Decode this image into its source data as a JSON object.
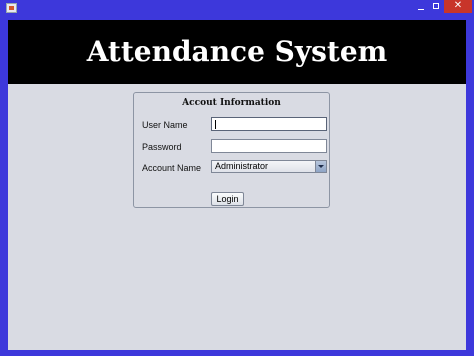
{
  "window": {
    "controls": {
      "minimize": "",
      "maximize": "",
      "close": "✕"
    }
  },
  "banner": {
    "title": "Attendance System"
  },
  "form": {
    "title": "Accout Information",
    "username_label": "User Name",
    "username_value": "",
    "password_label": "Password",
    "password_value": "",
    "account_label": "Account Name",
    "account_selected": "Administrator",
    "login_label": "Login"
  },
  "colors": {
    "window_frame": "#3d38db",
    "banner_bg": "#000000",
    "banner_text": "#ffffff",
    "content_bg": "#d9dbe3",
    "close_button": "#c8352a"
  },
  "icons": {
    "app": "java-app-icon",
    "dropdown": "chevron-down-icon"
  }
}
